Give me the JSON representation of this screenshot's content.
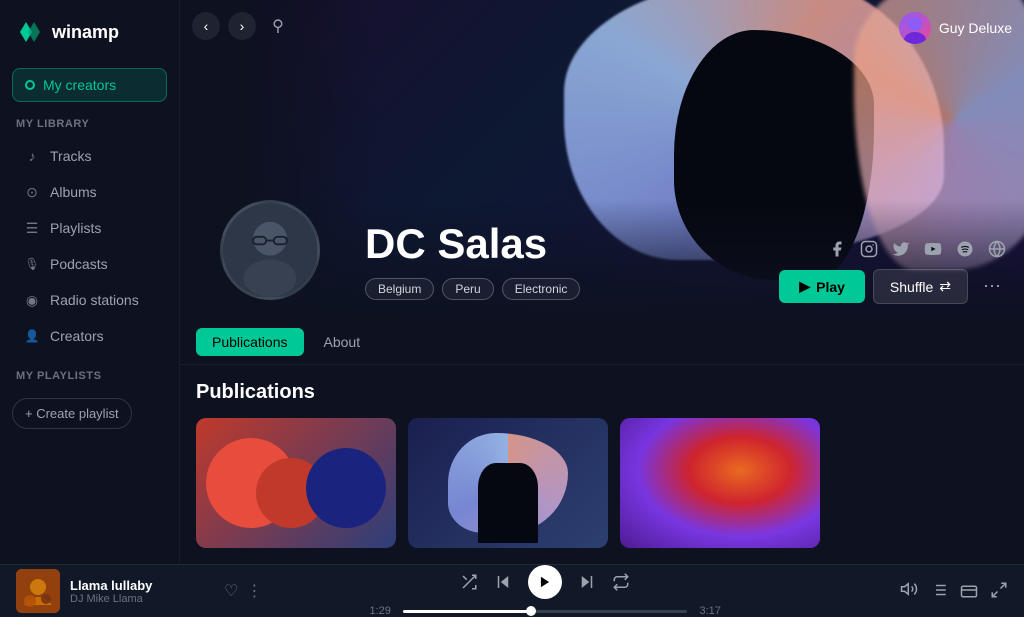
{
  "app": {
    "name": "winamp"
  },
  "sidebar": {
    "my_creators_label": "My creators",
    "my_library_label": "My library",
    "items": [
      {
        "id": "tracks",
        "label": "Tracks",
        "icon": "music-icon"
      },
      {
        "id": "albums",
        "label": "Albums",
        "icon": "album-icon"
      },
      {
        "id": "playlists",
        "label": "Playlists",
        "icon": "playlist-icon"
      },
      {
        "id": "podcasts",
        "label": "Podcasts",
        "icon": "podcast-icon"
      },
      {
        "id": "radio-stations",
        "label": "Radio stations",
        "icon": "radio-icon"
      },
      {
        "id": "creators",
        "label": "Creators",
        "icon": "creators-icon"
      }
    ],
    "my_playlists_label": "My playlists",
    "create_playlist_label": "+ Create playlist"
  },
  "hero": {
    "nav": {
      "back_label": "‹",
      "forward_label": "›",
      "search_label": "🔍"
    },
    "user": {
      "name": "Guy Deluxe"
    },
    "artist": {
      "name": "DC Salas",
      "tags": [
        "Belgium",
        "Peru",
        "Electronic"
      ]
    },
    "social": [
      "f",
      "inst",
      "tw",
      "yt",
      "sp",
      "web"
    ],
    "buttons": {
      "play": "Play",
      "shuffle": "Shuffle"
    }
  },
  "tabs": [
    {
      "id": "publications",
      "label": "Publications",
      "active": true
    },
    {
      "id": "about",
      "label": "About",
      "active": false
    }
  ],
  "publications": {
    "title": "Publications",
    "cards": [
      {
        "id": 1,
        "type": "abstract-circles"
      },
      {
        "id": 2,
        "type": "abstract-person"
      },
      {
        "id": 3,
        "type": "abstract-bird"
      }
    ]
  },
  "player": {
    "track": {
      "title": "Llama lullaby",
      "artist": "DJ Mike Llama"
    },
    "time_current": "1:29",
    "time_total": "3:17",
    "progress_percent": 45
  }
}
